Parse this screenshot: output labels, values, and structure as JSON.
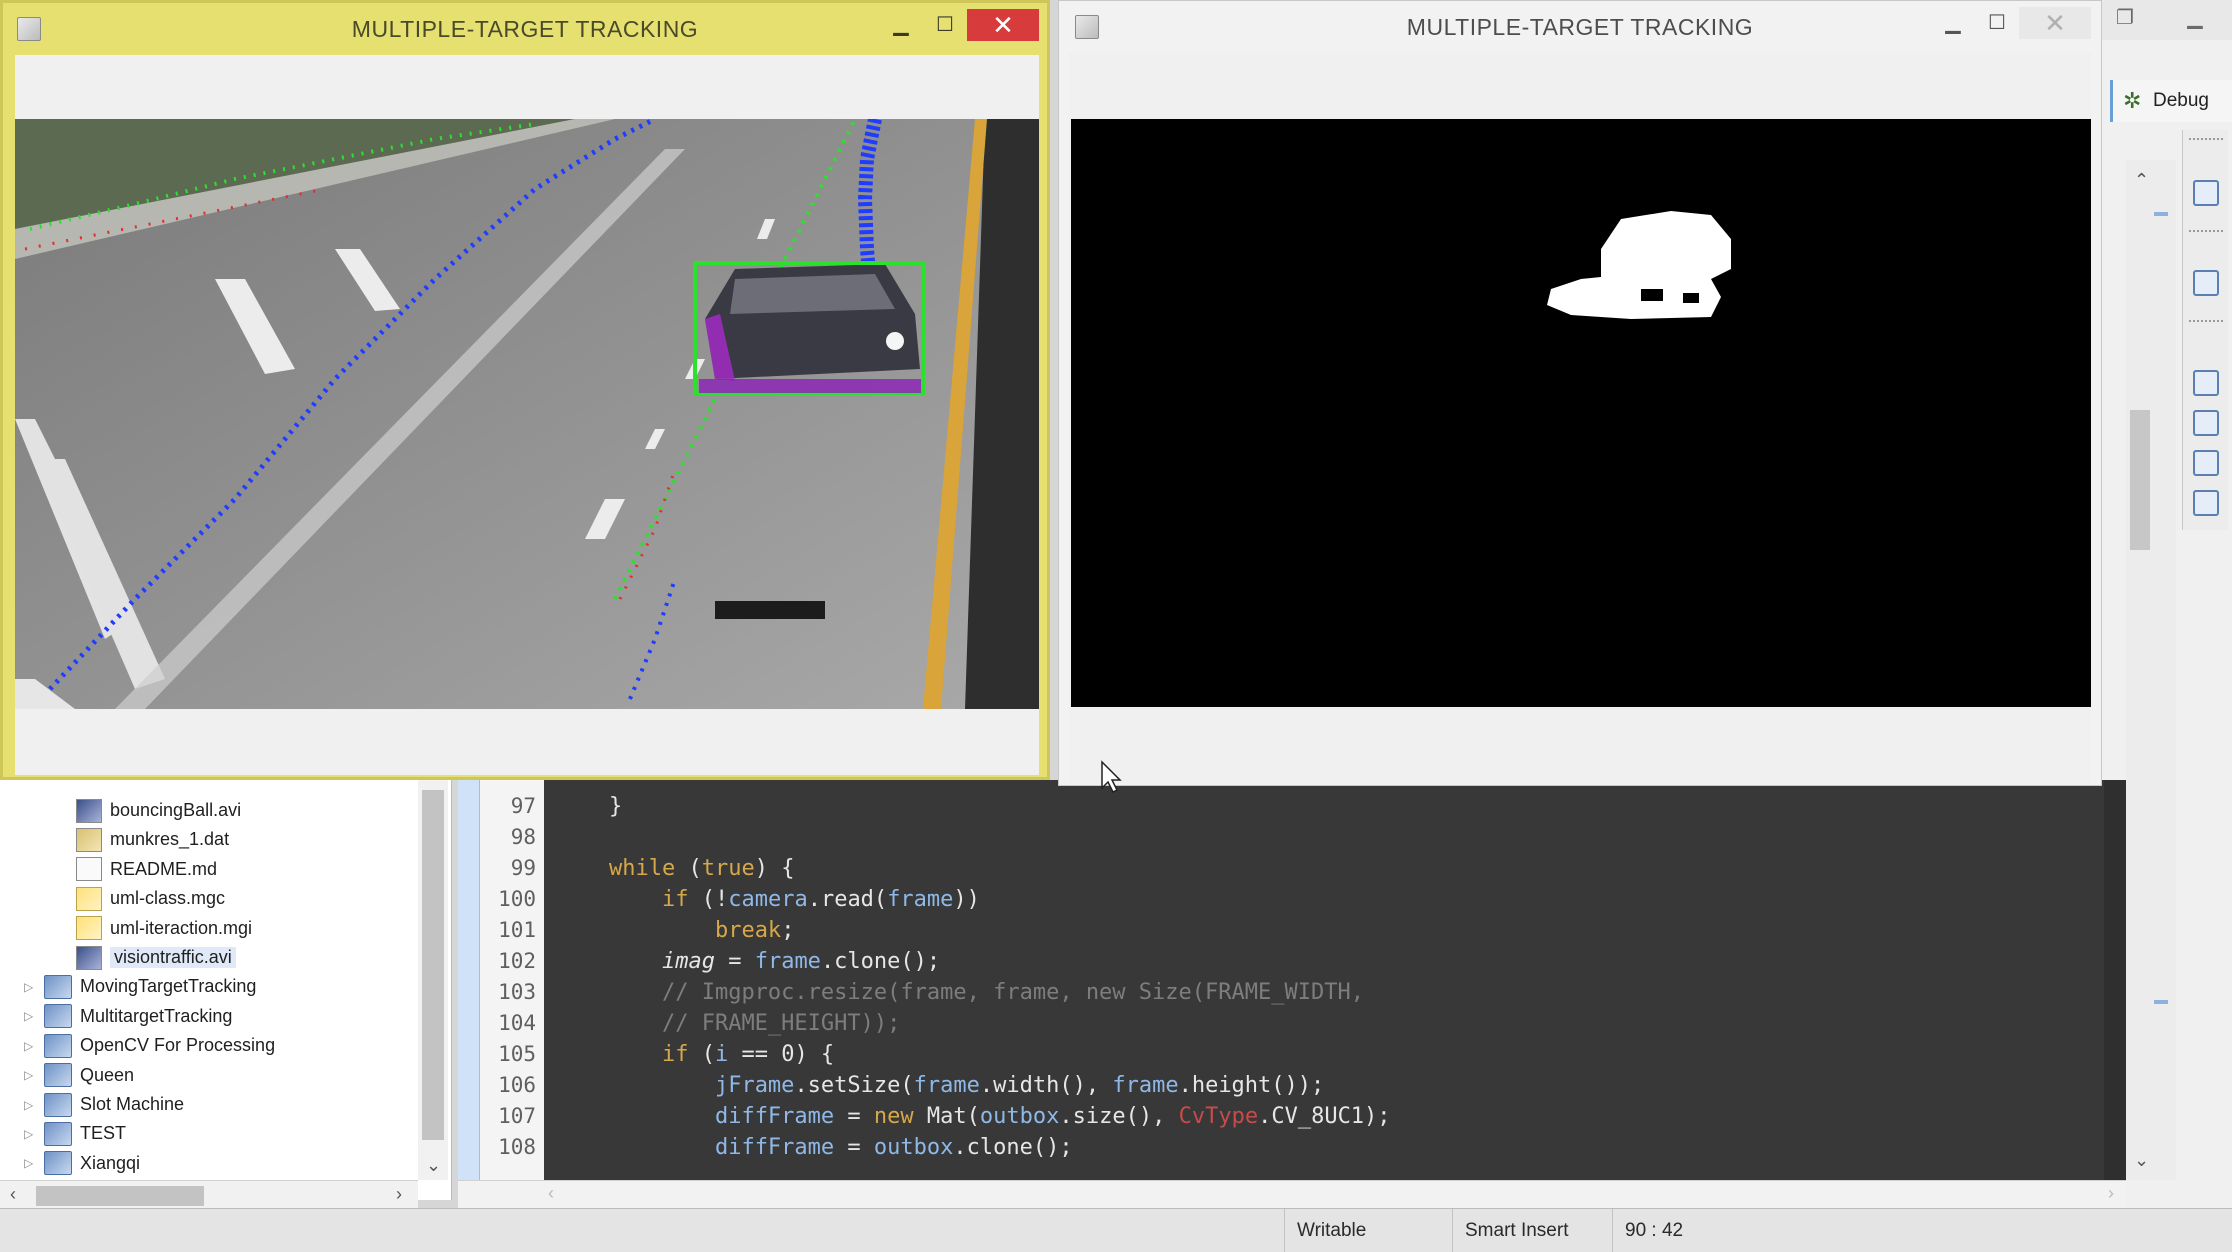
{
  "windows": {
    "tracking_left": {
      "title": "MULTIPLE-TARGET TRACKING"
    },
    "tracking_right": {
      "title": "MULTIPLE-TARGET TRACKING"
    }
  },
  "window_controls": {
    "minimize": "▁",
    "maximize": "☐",
    "close": "✕"
  },
  "ide": {
    "debug_label": "Debug"
  },
  "explorer": {
    "files": [
      {
        "name": "bouncingBall.avi",
        "icon": "movie"
      },
      {
        "name": "munkres_1.dat",
        "icon": "dat"
      },
      {
        "name": "README.md",
        "icon": "doc"
      },
      {
        "name": "uml-class.mgc",
        "icon": "uml"
      },
      {
        "name": "uml-iteraction.mgi",
        "icon": "uml"
      },
      {
        "name": "visiontraffic.avi",
        "icon": "movie"
      }
    ],
    "projects": [
      "MovingTargetTracking",
      "MultitargetTracking",
      "OpenCV For Processing",
      "Queen",
      "Slot Machine",
      "TEST",
      "Xiangqi"
    ]
  },
  "editor": {
    "lines": [
      {
        "no": "97",
        "html": "    }"
      },
      {
        "no": "98",
        "html": ""
      },
      {
        "no": "99",
        "html": "    <span class='kw'>while</span> (<span class='kw'>true</span>) {"
      },
      {
        "no": "100",
        "html": "        <span class='kw'>if</span> (!<span class='var'>camera</span>.read(<span class='var'>frame</span>))"
      },
      {
        "no": "101",
        "html": "            <span class='kw'>break</span>;"
      },
      {
        "no": "102",
        "html": "        <i>imag</i> = <span class='var'>frame</span>.clone();"
      },
      {
        "no": "103",
        "html": "        <span class='cm'>// Imgproc.resize(frame, frame, new Size(FRAME_WIDTH,</span>"
      },
      {
        "no": "104",
        "html": "        <span class='cm'>// FRAME_HEIGHT));</span>"
      },
      {
        "no": "105",
        "html": "        <span class='kw'>if</span> (<span class='var'>i</span> == 0) {"
      },
      {
        "no": "106",
        "html": "            <span class='var'>jFrame</span>.setSize(<span class='var'>frame</span>.width(), <span class='var'>frame</span>.height());"
      },
      {
        "no": "107",
        "html": "            <span class='var'>diffFrame</span> = <span class='kw'>new</span> Mat(<span class='var'>outbox</span>.size(), <span class='red'>CvType</span>.CV_8UC1);"
      },
      {
        "no": "108",
        "html": "            <span class='var'>diffFrame</span> = <span class='var'>outbox</span>.clone();"
      }
    ]
  },
  "statusbar": {
    "writable": "Writable",
    "insert_mode": "Smart Insert",
    "position": "90 : 42"
  },
  "colors": {
    "active_title": "#e6e070",
    "bbox": "#2ee02e",
    "track_blue": "#1f3cff",
    "close_red": "#d83b3b"
  }
}
